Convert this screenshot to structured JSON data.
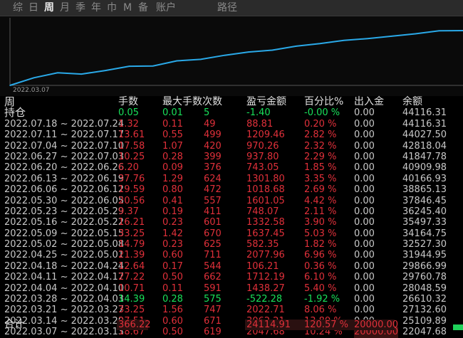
{
  "tabs": [
    {
      "label": "综",
      "active": false
    },
    {
      "label": "日",
      "active": false
    },
    {
      "label": "周",
      "active": true
    },
    {
      "label": "月",
      "active": false
    },
    {
      "label": "季",
      "active": false
    },
    {
      "label": "年",
      "active": false
    },
    {
      "label": "巾",
      "active": false
    },
    {
      "label": "M",
      "active": false
    },
    {
      "label": "备",
      "active": false
    },
    {
      "label": "账户",
      "active": false
    },
    {
      "label": "路径",
      "active": false
    }
  ],
  "chart": {
    "start_date": "2022.03.07",
    "line_color": "#2aa9e8",
    "chart_data": {
      "type": "line",
      "title": "",
      "xlabel": "",
      "ylabel": "",
      "x": [
        "2022.03.07",
        "2022.03.14",
        "2022.03.21",
        "2022.03.28",
        "2022.04.04",
        "2022.04.11",
        "2022.04.18",
        "2022.04.25",
        "2022.05.02",
        "2022.05.09",
        "2022.05.16",
        "2022.05.23",
        "2022.05.30",
        "2022.06.06",
        "2022.06.13",
        "2022.06.20",
        "2022.06.27",
        "2022.07.04",
        "2022.07.11",
        "2022.07.18"
      ],
      "values": [
        22047.68,
        25109.89,
        27132.6,
        26610.32,
        28048.59,
        29760.78,
        29866.99,
        31944.95,
        32527.3,
        34164.75,
        35497.33,
        36245.4,
        37846.45,
        38865.13,
        40166.93,
        40909.98,
        41847.78,
        42818.04,
        44027.5,
        44116.31
      ]
    }
  },
  "table": {
    "headers": {
      "period": "周",
      "lots": "手数",
      "max_lots": "最大手数",
      "count": "次数",
      "pnl": "盈亏金额",
      "percent": "百分比%",
      "flow": "出入金",
      "balance": "余额"
    },
    "holding": {
      "label": "持仓",
      "lots": "0.05",
      "max_lots": "0.01",
      "count": "5",
      "pnl": "-1.40",
      "percent": "-0.00 %",
      "flow": "0.00",
      "balance": "44116.31"
    },
    "rows": [
      {
        "period": "2022.07.18 ~ 2022.07.24",
        "lots": "1.32",
        "max_lots": "0.11",
        "count": "49",
        "pnl": "88.81",
        "percent": "0.20 %",
        "flow": "0.00",
        "balance": "44116.31",
        "sign": "pos"
      },
      {
        "period": "2022.07.11 ~ 2022.07.17",
        "lots": "13.61",
        "max_lots": "0.55",
        "count": "499",
        "pnl": "1209.46",
        "percent": "2.82 %",
        "flow": "0.00",
        "balance": "44027.50",
        "sign": "pos"
      },
      {
        "period": "2022.07.04 ~ 2022.07.10",
        "lots": "17.58",
        "max_lots": "1.07",
        "count": "420",
        "pnl": "970.26",
        "percent": "2.32 %",
        "flow": "0.00",
        "balance": "42818.04",
        "sign": "pos"
      },
      {
        "period": "2022.06.27 ~ 2022.07.03",
        "lots": "10.25",
        "max_lots": "0.28",
        "count": "399",
        "pnl": "937.80",
        "percent": "2.29 %",
        "flow": "0.00",
        "balance": "41847.78",
        "sign": "pos"
      },
      {
        "period": "2022.06.20 ~ 2022.06.26",
        "lots": "6.20",
        "max_lots": "0.09",
        "count": "376",
        "pnl": "743.05",
        "percent": "1.85 %",
        "flow": "0.00",
        "balance": "40909.98",
        "sign": "pos"
      },
      {
        "period": "2022.06.13 ~ 2022.06.19",
        "lots": "37.76",
        "max_lots": "1.29",
        "count": "624",
        "pnl": "1301.80",
        "percent": "3.35 %",
        "flow": "0.00",
        "balance": "40166.93",
        "sign": "pos"
      },
      {
        "period": "2022.06.06 ~ 2022.06.12",
        "lots": "19.59",
        "max_lots": "0.80",
        "count": "472",
        "pnl": "1018.68",
        "percent": "2.69 %",
        "flow": "0.00",
        "balance": "38865.13",
        "sign": "pos"
      },
      {
        "period": "2022.05.30 ~ 2022.06.05",
        "lots": "20.56",
        "max_lots": "0.41",
        "count": "557",
        "pnl": "1601.05",
        "percent": "4.42 %",
        "flow": "0.00",
        "balance": "37846.45",
        "sign": "pos"
      },
      {
        "period": "2022.05.23 ~ 2022.05.29",
        "lots": "9.37",
        "max_lots": "0.19",
        "count": "411",
        "pnl": "748.07",
        "percent": "2.11 %",
        "flow": "0.00",
        "balance": "36245.40",
        "sign": "pos"
      },
      {
        "period": "2022.05.16 ~ 2022.05.22",
        "lots": "16.21",
        "max_lots": "0.23",
        "count": "601",
        "pnl": "1332.58",
        "percent": "3.90 %",
        "flow": "0.00",
        "balance": "35497.33",
        "sign": "pos"
      },
      {
        "period": "2022.05.09 ~ 2022.05.15",
        "lots": "33.25",
        "max_lots": "1.42",
        "count": "670",
        "pnl": "1637.45",
        "percent": "5.03 %",
        "flow": "0.00",
        "balance": "34164.75",
        "sign": "pos"
      },
      {
        "period": "2022.05.02 ~ 2022.05.08",
        "lots": "14.79",
        "max_lots": "0.23",
        "count": "625",
        "pnl": "582.35",
        "percent": "1.82 %",
        "flow": "0.00",
        "balance": "32527.30",
        "sign": "pos"
      },
      {
        "period": "2022.04.25 ~ 2022.05.01",
        "lots": "21.39",
        "max_lots": "0.60",
        "count": "711",
        "pnl": "2077.96",
        "percent": "6.96 %",
        "flow": "0.00",
        "balance": "31944.95",
        "sign": "pos"
      },
      {
        "period": "2022.04.18 ~ 2022.04.24",
        "lots": "12.64",
        "max_lots": "0.17",
        "count": "544",
        "pnl": "106.21",
        "percent": "0.36 %",
        "flow": "0.00",
        "balance": "29866.99",
        "sign": "pos"
      },
      {
        "period": "2022.04.11 ~ 2022.04.17",
        "lots": "27.22",
        "max_lots": "0.50",
        "count": "662",
        "pnl": "1712.19",
        "percent": "6.10 %",
        "flow": "0.00",
        "balance": "29760.78",
        "sign": "pos"
      },
      {
        "period": "2022.04.04 ~ 2022.04.10",
        "lots": "10.71",
        "max_lots": "0.11",
        "count": "591",
        "pnl": "1438.27",
        "percent": "5.40 %",
        "flow": "0.00",
        "balance": "28048.59",
        "sign": "pos"
      },
      {
        "period": "2022.03.28 ~ 2022.04.03",
        "lots": "14.39",
        "max_lots": "0.28",
        "count": "575",
        "pnl": "-522.28",
        "percent": "-1.92 %",
        "flow": "0.00",
        "balance": "26610.32",
        "sign": "neg"
      },
      {
        "period": "2022.03.21 ~ 2022.03.27",
        "lots": "33.25",
        "max_lots": "1.56",
        "count": "747",
        "pnl": "2022.71",
        "percent": "8.06 %",
        "flow": "0.00",
        "balance": "27132.60",
        "sign": "pos"
      },
      {
        "period": "2022.03.14 ~ 2022.03.20",
        "lots": "27.51",
        "max_lots": "0.60",
        "count": "671",
        "pnl": "3062.21",
        "percent": "13.89 %",
        "flow": "0.00",
        "balance": "25109.89",
        "sign": "pos"
      },
      {
        "period": "2022.03.07 ~ 2022.03.13",
        "lots": "18.67",
        "max_lots": "0.50",
        "count": "619",
        "pnl": "2047.68",
        "percent": "10.24 %",
        "flow": "20000.00",
        "balance": "22047.68",
        "sign": "pos"
      }
    ],
    "total": {
      "label": "合计",
      "lots": "366.22",
      "pnl": "24114.91",
      "percent": "120.57 %",
      "flow": "20000.00"
    }
  }
}
